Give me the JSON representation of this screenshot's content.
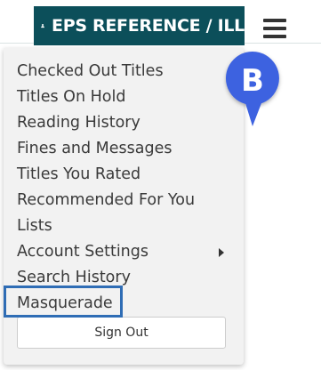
{
  "header": {
    "account_label": "EPS REFERENCE / ILL",
    "account_icon": "user-icon",
    "menu_icon": "hamburger-menu-icon",
    "brand_color": "#0c4f5a"
  },
  "dropdown": {
    "items": [
      {
        "label": "Checked Out Titles"
      },
      {
        "label": "Titles On Hold"
      },
      {
        "label": "Reading History"
      },
      {
        "label": "Fines and Messages"
      },
      {
        "label": "Titles You Rated"
      },
      {
        "label": "Recommended For You"
      },
      {
        "label": "Lists"
      },
      {
        "label": "Account Settings",
        "submenu_icon": "caret-right-icon"
      },
      {
        "label": "Search History"
      },
      {
        "label": "Masquerade",
        "highlighted": true
      }
    ],
    "sign_out_label": "Sign Out"
  },
  "annotation": {
    "badge_letter": "B",
    "badge_color": "#3d62e0",
    "highlight_color": "#2f6db5"
  }
}
